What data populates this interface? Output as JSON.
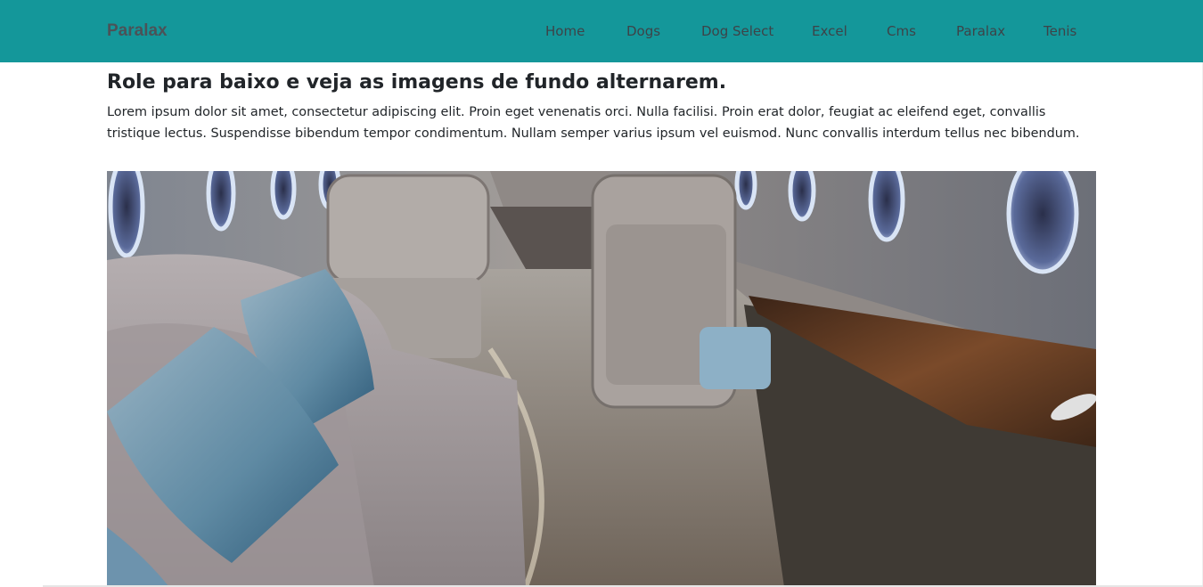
{
  "navbar": {
    "brand": "Paralax",
    "links": [
      "Home",
      "Dogs",
      "Dog Select",
      "Excel",
      "Cms",
      "Paralax",
      "Tenis"
    ],
    "bg_color": "#14979a"
  },
  "main": {
    "heading": "Role para baixo e veja as imagens de fundo alternarem.",
    "paragraph": "Lorem ipsum dolor sit amet, consectetur adipiscing elit. Proin eget venenatis orci. Nulla facilisi. Proin erat dolor, feugiat ac eleifend eget, convallis tristique lectus. Suspendisse bibendum tempor condimentum. Nullam semper varius ipsum vel euismod. Nunc convallis interdum tellus nec bibendum."
  }
}
